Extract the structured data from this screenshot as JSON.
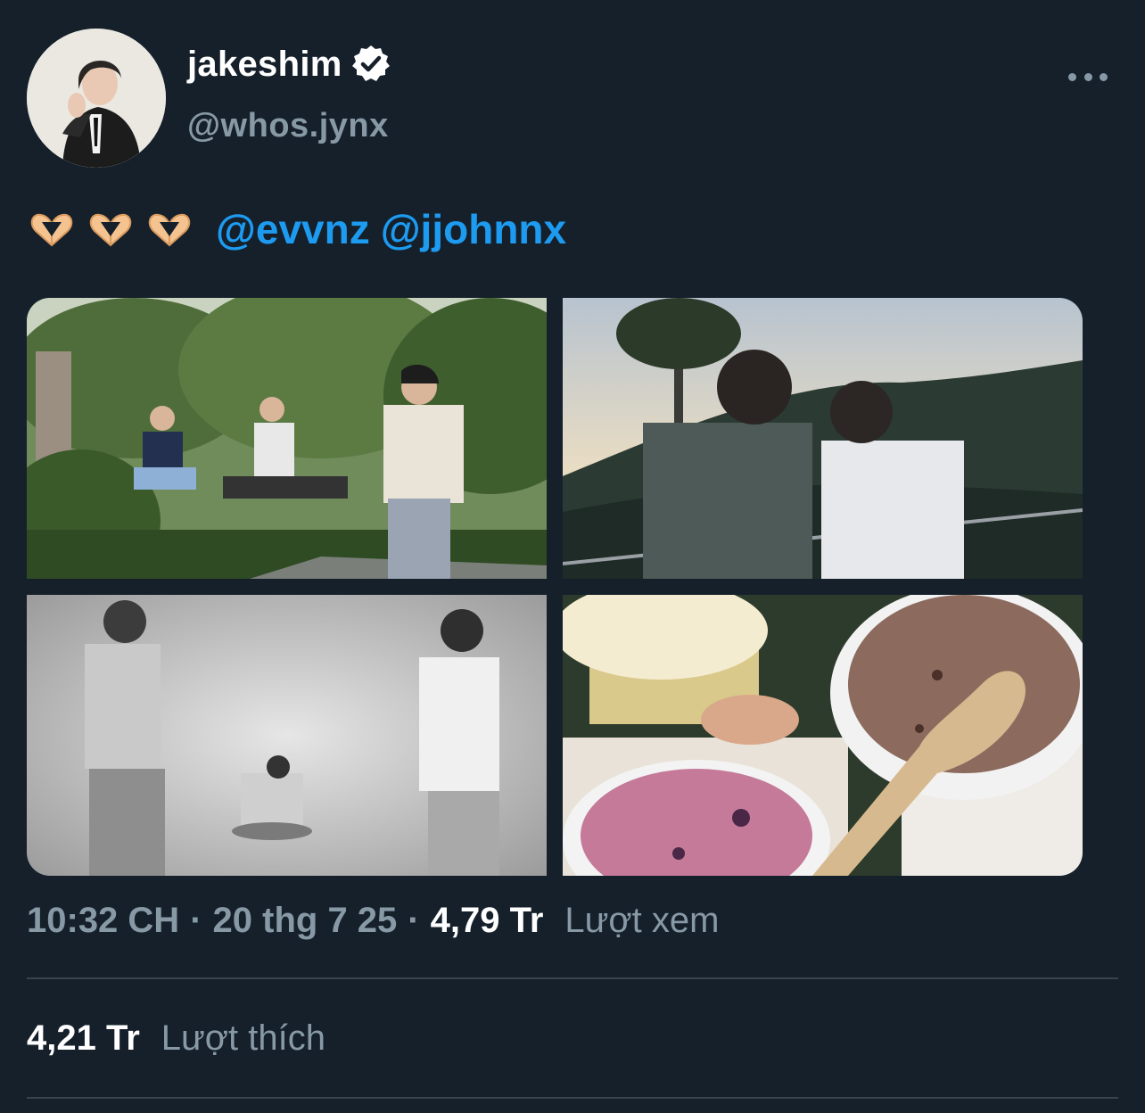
{
  "author": {
    "display_name": "jakeshim",
    "handle": "@whos.jynx",
    "verified": true,
    "avatar_icon": "profile-photo"
  },
  "menu": {
    "icon": "more-horizontal-icon"
  },
  "tweet": {
    "emoji": [
      "🫶",
      "🫶",
      "🫶"
    ],
    "mentions": [
      "@evvnz",
      "@jjohnnx"
    ]
  },
  "media": [
    {
      "description_icon": "photo-garden-jump"
    },
    {
      "description_icon": "photo-sunset-hill"
    },
    {
      "description_icon": "photo-studio-bw"
    },
    {
      "description_icon": "photo-ice-cream"
    }
  ],
  "meta": {
    "time": "10:32 CH",
    "separator": "·",
    "date": "20 thg 7 25",
    "views_count": "4,79 Tr",
    "views_label": "Lượt xem"
  },
  "likes": {
    "count": "4,21 Tr",
    "label": "Lượt thích"
  },
  "colors": {
    "background": "#15202b",
    "link": "#1d9bf0",
    "muted": "#8899a6",
    "divider": "#38444d"
  }
}
